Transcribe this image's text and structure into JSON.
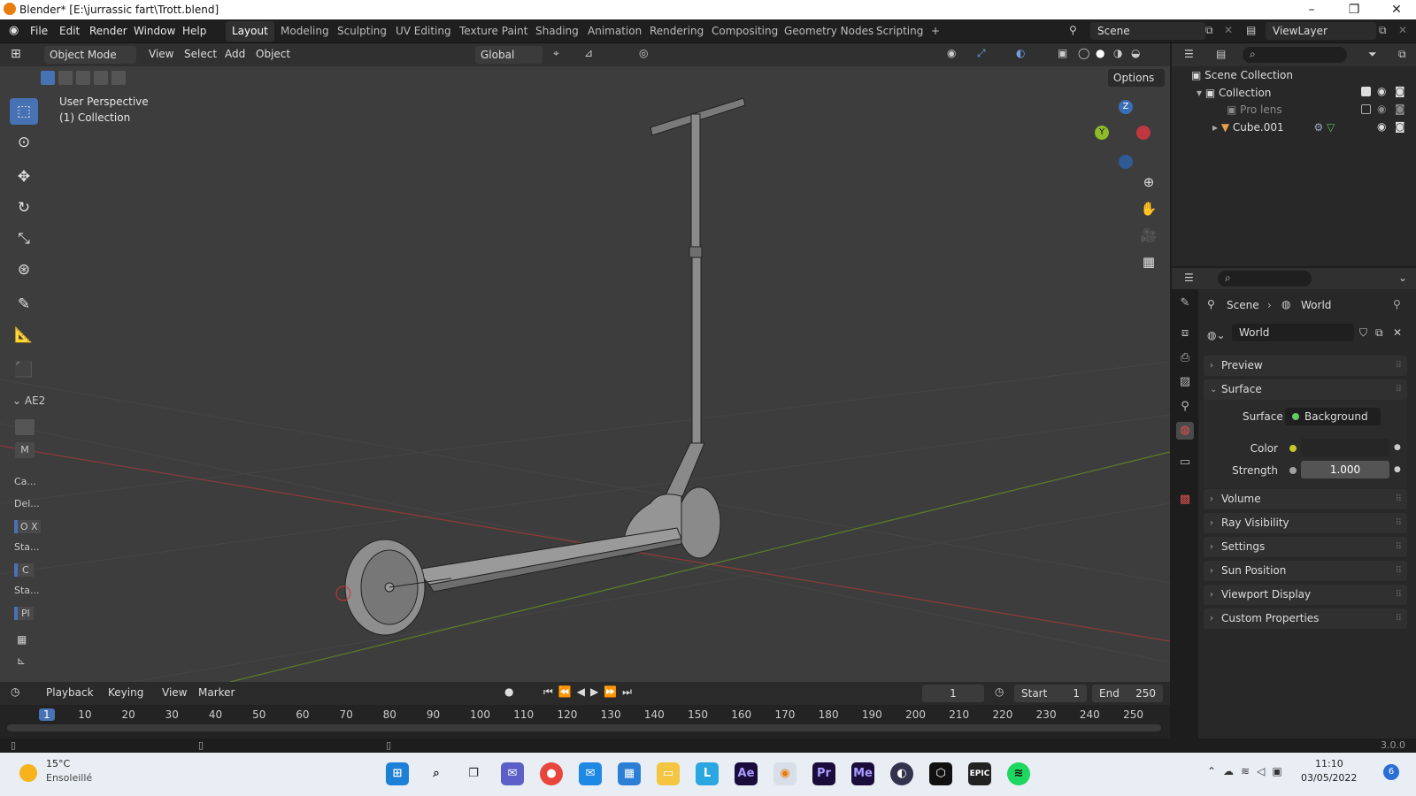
{
  "window": {
    "title": "Blender* [E:\\jurrassic fart\\Trott.blend]",
    "min": "–",
    "max": "❐",
    "close": "✕"
  },
  "menus": [
    "File",
    "Edit",
    "Render",
    "Window",
    "Help"
  ],
  "workspaces": [
    "Layout",
    "Modeling",
    "Sculpting",
    "UV Editing",
    "Texture Paint",
    "Shading",
    "Animation",
    "Rendering",
    "Compositing",
    "Geometry Nodes",
    "Scripting",
    "+"
  ],
  "scene_name": "Scene",
  "view_layer": "ViewLayer",
  "viewport_header": {
    "mode": "Object Mode",
    "menus": [
      "View",
      "Select",
      "Add",
      "Object"
    ],
    "transform": "Global",
    "options": "Options"
  },
  "viewport": {
    "perspective": "User Perspective",
    "collection": "(1) Collection",
    "axis_z": "Z",
    "axis_y": "Y"
  },
  "tool_panel": {
    "section": "AE2",
    "labels": [
      "M",
      "Ca...",
      "Del...",
      "O X",
      "Sta...",
      "C",
      "Sta...",
      "Pl"
    ]
  },
  "outliner": {
    "items": [
      {
        "label": "Scene Collection"
      },
      {
        "label": "Collection"
      },
      {
        "label": "Pro lens"
      },
      {
        "label": "Cube.001"
      }
    ]
  },
  "properties": {
    "breadcrumb": [
      "Scene",
      "World"
    ],
    "world_name": "World",
    "panels": [
      "Preview",
      "Surface",
      "Volume",
      "Ray Visibility",
      "Settings",
      "Sun Position",
      "Viewport Display",
      "Custom Properties"
    ],
    "surface_label": "Surface",
    "surface_value": "Background",
    "color_label": "Color",
    "strength_label": "Strength",
    "strength_value": "1.000"
  },
  "timeline": {
    "menus": [
      "Playback",
      "Keying",
      "View",
      "Marker"
    ],
    "current_frame": "1",
    "start_label": "Start",
    "start_value": "1",
    "end_label": "End",
    "end_value": "250",
    "frame_marks": [
      "1",
      "10",
      "20",
      "30",
      "40",
      "50",
      "60",
      "70",
      "80",
      "90",
      "100",
      "110",
      "120",
      "130",
      "140",
      "150",
      "160",
      "170",
      "180",
      "190",
      "200",
      "210",
      "220",
      "230",
      "240",
      "250"
    ]
  },
  "version": "3.0.0",
  "taskbar": {
    "weather_temp": "15°C",
    "weather_desc": "Ensoleillé",
    "time": "11:10",
    "date": "03/05/2022",
    "notif_count": "6",
    "apps": [
      "Ae",
      "Pr",
      "Me"
    ]
  },
  "colors": {
    "accent": "#4772b3",
    "x_axis": "#b23b3b",
    "y_axis": "#6a8a2a",
    "blender_orange": "#e87d0d"
  }
}
